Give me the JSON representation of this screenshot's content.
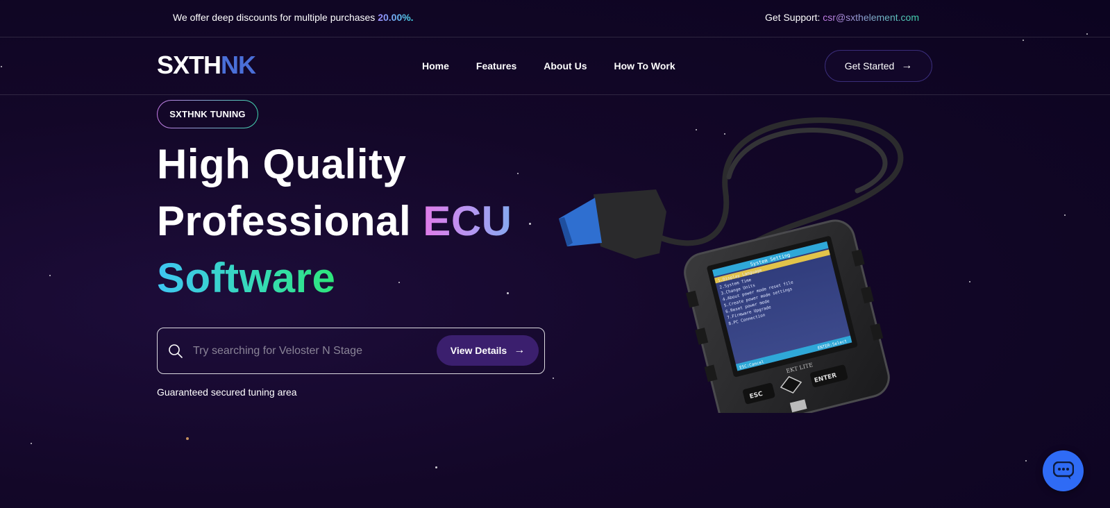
{
  "topbar": {
    "promo_text": "We offer deep discounts for multiple purchases",
    "promo_percent": "20.00%.",
    "support_label": "Get Support:",
    "support_email": "csr@sxthelement.com"
  },
  "brand": {
    "logo_part1": "SXTH",
    "logo_part2": "NK"
  },
  "nav": {
    "items": [
      "Home",
      "Features",
      "About Us",
      "How To Work"
    ]
  },
  "header": {
    "cta_label": "Get Started"
  },
  "hero": {
    "badge": "SXTHNK TUNING",
    "line1": "High Quality",
    "line2_plain": "Professional ",
    "line2_accent": "ECU",
    "line3": "Software",
    "search": {
      "placeholder": "Try searching for Veloster N Stage",
      "button_label": "View Details"
    },
    "guarantee": "Guaranteed secured tuning area"
  },
  "device_screen": {
    "title": "System Setting",
    "menu": [
      "1.Display Language",
      "2.System Time",
      "3.Change Units",
      "4.About power mode reset file",
      "5.Create power mode settings",
      "6.Reset power mode",
      "7.Firmware Upgrade",
      "8.PC Connection"
    ],
    "footer_left": "ESC:Cancel",
    "footer_right": "ENTER:Select",
    "brand": "EKT LITE",
    "button_esc": "ESC",
    "button_enter": "ENTER"
  },
  "colors": {
    "accent_purple": "#3b1f6e",
    "chat_blue": "#2f6bf5",
    "logo_blue": "#4a6fd8"
  }
}
